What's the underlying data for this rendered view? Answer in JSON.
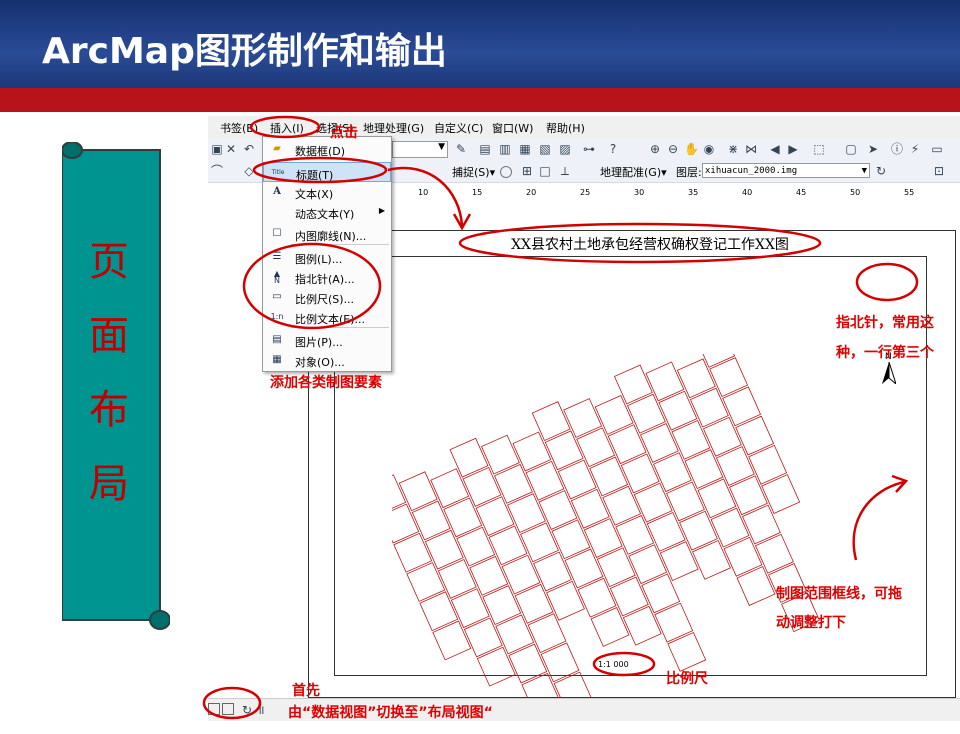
{
  "banner": {
    "title": "ArcMap图形制作和输出"
  },
  "sidebar": {
    "chars": [
      "页",
      "面",
      "布",
      "局"
    ]
  },
  "menubar": {
    "items": [
      "书签(B)",
      "插入(I)",
      "选择(S)",
      "地理处理(G)",
      "自定义(C)",
      "窗口(W)",
      "帮助(H)"
    ]
  },
  "toolbar": {
    "snapping": "捕捉(S)▾",
    "georef": "地理配准(G)▾",
    "layer_label": "图层:",
    "layer_value": "xihuacun_2000.img"
  },
  "ruler": {
    "ticks": [
      "10",
      "15",
      "20",
      "25",
      "30",
      "35",
      "40",
      "45",
      "50",
      "55"
    ]
  },
  "insert_menu": {
    "items": [
      {
        "label": "数据框(D)",
        "icon": "data-frame-icon"
      },
      {
        "label": "标题(T)",
        "icon": "title-icon"
      },
      {
        "label": "文本(X)",
        "icon": "text-icon"
      },
      {
        "label": "动态文本(Y)",
        "icon": ""
      },
      {
        "label": "内图廓线(N)...",
        "icon": "neatline-icon"
      },
      {
        "label": "图例(L)...",
        "icon": "legend-icon"
      },
      {
        "label": "指北针(A)...",
        "icon": "north-arrow-icon"
      },
      {
        "label": "比例尺(S)...",
        "icon": "scale-bar-icon"
      },
      {
        "label": "比例文本(E)...",
        "icon": "scale-text-icon"
      },
      {
        "label": "图片(P)...",
        "icon": "picture-icon"
      },
      {
        "label": "对象(O)...",
        "icon": "object-icon"
      }
    ]
  },
  "map": {
    "title": "XX县农村土地承包经营权确权登记工作XX图",
    "north_label": "N",
    "scale_text": "1:1 000"
  },
  "annotations": {
    "click": "点击",
    "add_elements": "添加各类制图要素",
    "north_note_1": "指北针，常用这",
    "north_note_2": "种，一行第三个",
    "frame_note_1": "制图范围框线，可拖",
    "frame_note_2": "动调整打下",
    "scale_note": "比例尺",
    "first": "首先",
    "switch_note": "由“数据视图”切换至”布局视图“"
  },
  "colors": {
    "banner": "#1f3b82",
    "accent_bar": "#b8121a",
    "scroll": "#009490",
    "annot": "#e00000"
  }
}
